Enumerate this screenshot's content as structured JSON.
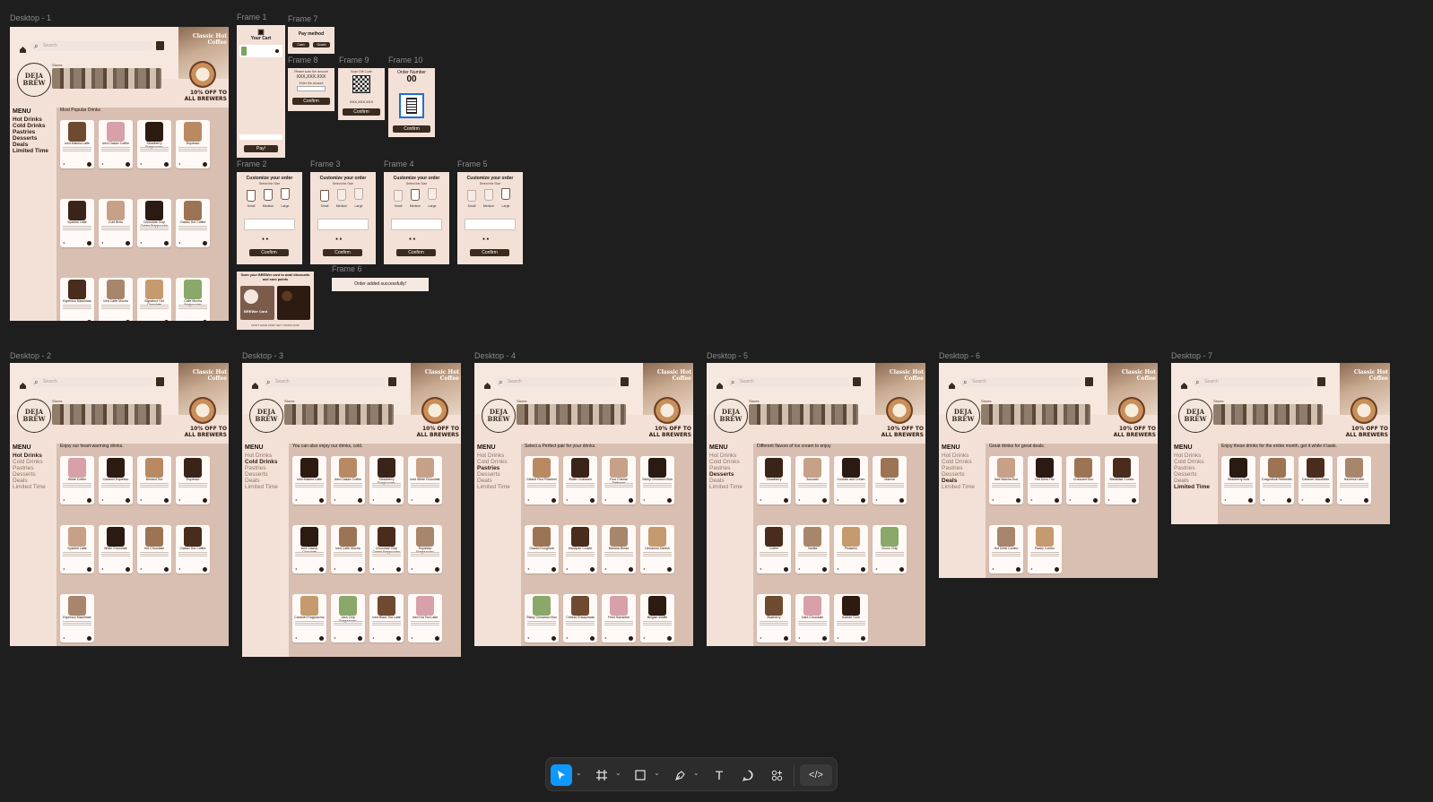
{
  "frames": {
    "desktop1": "Desktop - 1",
    "desktop2": "Desktop - 2",
    "desktop3": "Desktop - 3",
    "desktop4": "Desktop - 4",
    "desktop5": "Desktop - 5",
    "desktop6": "Desktop - 6",
    "desktop7": "Desktop - 7",
    "frame1": "Frame 1",
    "frame2": "Frame 2",
    "frame3": "Frame 3",
    "frame4": "Frame 4",
    "frame5": "Frame 5",
    "frame6": "Frame 6",
    "frame7": "Frame 7",
    "frame8": "Frame 8",
    "frame9": "Frame 9",
    "frame10": "Frame 10"
  },
  "site": {
    "search_placeholder": "Search",
    "promo_title": "Classic Hot Coffee",
    "promo_offer": "10% OFF TO ALL BREWERS",
    "logo_line1": "DEJA",
    "logo_line2": "BREW",
    "store_label": "Stores",
    "menu_title": "MENU",
    "categories": [
      "Hot Drinks",
      "Cold Drinks",
      "Pastries",
      "Desserts",
      "Deals",
      "Limited Time"
    ]
  },
  "sections": {
    "d1": "Most Popular Drinks",
    "d2": "Enjoy our heart-warming drinks.",
    "d3": "You can also enjoy our drinks, cold.",
    "d4": "Select a Perfect pair for your drinks.",
    "d5": "Different flavors of ice cream to enjoy",
    "d6": "Great drinks for great deals.",
    "d7": "Enjoy these drinks for the entire month, get it while it lasts."
  },
  "products": {
    "d1": [
      "Iced Matcha Latte",
      "Iced Classic Coffee",
      "Strawberry Frappuccino",
      "Espresso",
      "Spanish Latte",
      "Cold Brew",
      "Chocolate Chip Cream Frappuccino",
      "Classic Hot Coffee",
      "Espresso Macchiato",
      "Iced Caffe Mocha",
      "Signature Hot Chocolate",
      "Caffe Mocha Frappuccino"
    ],
    "d2": [
      "White Coffee",
      "Caramel Espresso",
      "Brewed Tea",
      "Espresso",
      "Spanish Latte",
      "White Chocolate",
      "Hot Chocolate",
      "Classic Hot Coffee",
      "Espresso Macchiato"
    ],
    "d3": [
      "Iced Matcha Latte",
      "Iced Classic Coffee",
      "Strawberry Frappuccino",
      "Iced White Chocolate",
      "Iced Classic Chocolate",
      "Iced Caffe Mocha",
      "Chocolate Chip Cream Frappuccino",
      "Espresso Frappuccino",
      "Caramel Frappuccino",
      "Java Chip Frappuccino",
      "Iced Black Tea Latte",
      "Iced Hot Tea Latte"
    ],
    "d4": [
      "Glazed Red Pinwheel",
      "Butter Croissant",
      "Four Cheese Flatbread",
      "Sticky Cinnamon Bun",
      "Glazed Doughnut",
      "Marzipan Cookie",
      "Banana Bread",
      "Cinnamon Danish",
      "Sticky Cinnamon Bun",
      "Cheese Ensaymada",
      "Fried Sandwich",
      "Belgian Waffle"
    ],
    "d5": [
      "Strawberry",
      "Avocado",
      "Cookies and Cream",
      "Matcha",
      "Coffee",
      "Vanilla",
      "Pistachio",
      "Choco Chip",
      "Blueberry",
      "Dark Chocolate",
      "Bubble Gum"
    ],
    "d6": [
      "Iced Matcha Duo",
      "Hot Drink Trio",
      "Croissant Duo",
      "Breakfast Combo",
      "Hot Drink Combo",
      "Pastry Combo"
    ],
    "d7": [
      "Strawberry Acai",
      "Dragonfruit Refresher",
      "Caramel Macchiato",
      "Hazelnut Latte"
    ]
  },
  "small_frames": {
    "cart_title": "Your Cart",
    "pay_button": "Pay!",
    "pay_method": "Pay method",
    "cash": "Cash",
    "gcash": "Gcash",
    "please_scan": "Please scan the amount",
    "amount": "XXX,XXX.XXX",
    "enter_amount": "Enter the amount",
    "scan_gift_code": "Scan Gift Code",
    "order_number": "Order Number",
    "order_number_value": "00",
    "customize_title": "Customize your order",
    "select_size": "Select the Size",
    "sizes": [
      "Small",
      "Medium",
      "Large"
    ],
    "confirm": "Confirm",
    "order_added": "Order added successfully!",
    "brewer_card_title": "Scan your BREWer card to avail discounts and earn points",
    "brewer_card_label": "BREWer Card",
    "no_card": "DON'T HAVE ONE? GET YOURS NOW"
  },
  "toolbar": {
    "tools": [
      "move-tool",
      "frame-tool",
      "shape-tool",
      "pen-tool",
      "text-tool",
      "comment-tool",
      "actions-tool",
      "dev-mode-toggle"
    ]
  },
  "colors": {
    "canvas": "#1e1e1e",
    "page_bg": "#f3e1d8",
    "content_bg": "#d9bfb1",
    "brand_dark": "#3b2a1e",
    "selection_blue": "#0d99ff"
  }
}
